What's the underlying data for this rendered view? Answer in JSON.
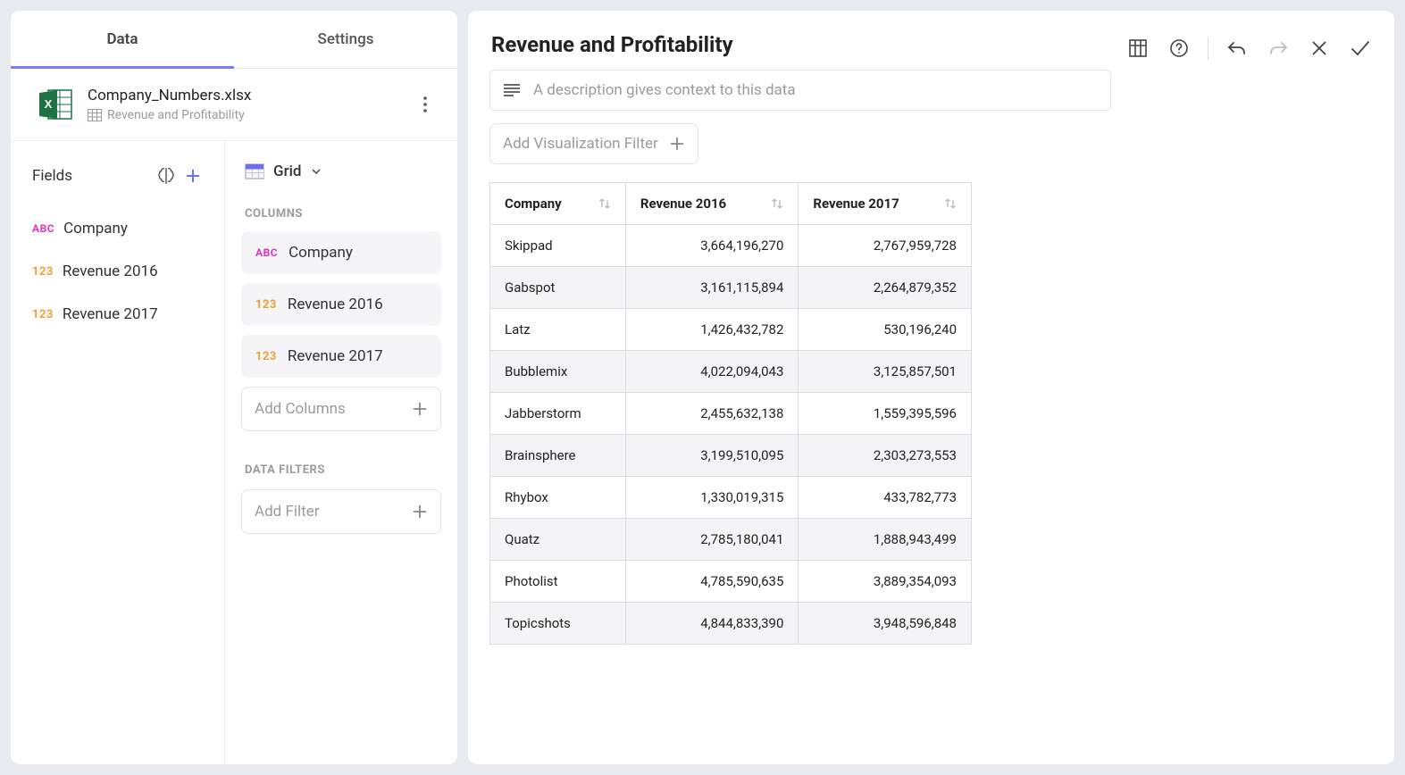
{
  "tabs": {
    "data": "Data",
    "settings": "Settings"
  },
  "file": {
    "name": "Company_Numbers.xlsx",
    "sheet": "Revenue and Profitability"
  },
  "fields": {
    "header": "Fields",
    "items": [
      {
        "type": "ABC",
        "label": "Company"
      },
      {
        "type": "123",
        "label": "Revenue 2016"
      },
      {
        "type": "123",
        "label": "Revenue 2017"
      }
    ]
  },
  "viz": {
    "type_label": "Grid",
    "columns_header": "COLUMNS",
    "columns": [
      {
        "type": "ABC",
        "label": "Company"
      },
      {
        "type": "123",
        "label": "Revenue 2016"
      },
      {
        "type": "123",
        "label": "Revenue 2017"
      }
    ],
    "add_columns_placeholder": "Add Columns",
    "filters_header": "DATA FILTERS",
    "add_filter_placeholder": "Add Filter"
  },
  "main": {
    "title": "Revenue and Profitability",
    "description_placeholder": "A description gives context to this data",
    "add_viz_filter": "Add Visualization Filter"
  },
  "table": {
    "headers": [
      "Company",
      "Revenue 2016",
      "Revenue 2017"
    ],
    "rows": [
      [
        "Skippad",
        "3,664,196,270",
        "2,767,959,728"
      ],
      [
        "Gabspot",
        "3,161,115,894",
        "2,264,879,352"
      ],
      [
        "Latz",
        "1,426,432,782",
        "530,196,240"
      ],
      [
        "Bubblemix",
        "4,022,094,043",
        "3,125,857,501"
      ],
      [
        "Jabberstorm",
        "2,455,632,138",
        "1,559,395,596"
      ],
      [
        "Brainsphere",
        "3,199,510,095",
        "2,303,273,553"
      ],
      [
        "Rhybox",
        "1,330,019,315",
        "433,782,773"
      ],
      [
        "Quatz",
        "2,785,180,041",
        "1,888,943,499"
      ],
      [
        "Photolist",
        "4,785,590,635",
        "3,889,354,093"
      ],
      [
        "Topicshots",
        "4,844,833,390",
        "3,948,596,848"
      ]
    ]
  }
}
